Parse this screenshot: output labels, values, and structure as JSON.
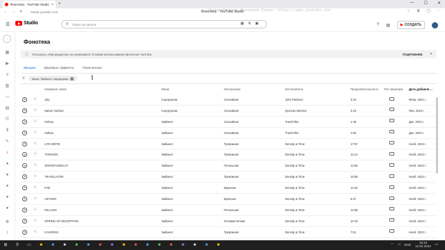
{
  "browser": {
    "tab_title": "Фонотека - YouTube Studio",
    "tab_close": "×",
    "new_tab": "+",
    "page_title": "Фонотека - YouTube Studio",
    "url": "studio.youtube.com",
    "overlay_text": "Уроки Кешина. Клоновый Канал: https://www.youtube.com",
    "win_min": "—",
    "win_max": "☐",
    "win_close": "✕"
  },
  "header": {
    "logo_text": "Studio",
    "search_placeholder": "Поиск на канале",
    "create_label": "СОЗДАТЬ"
  },
  "page": {
    "title": "Фонотека",
    "notice_text": "Пользуясь этим разделом, вы принимаете Условия использования фонотеки YouTube.",
    "notice_more": "ПОДРОБНЕЕ",
    "tabs": [
      {
        "label": "Музыка",
        "active": true
      },
      {
        "label": "Звуковые эффекты",
        "active": false
      },
      {
        "label": "Помеченные",
        "active": false
      }
    ],
    "filter_chip": "Жанр: Эмбиент, Саундтреки"
  },
  "table": {
    "headers": {
      "track": "Название трека",
      "genre": "Жанр",
      "mood": "Настроение",
      "artist": "Исполнитель",
      "duration": "Продолжительность",
      "license": "Тип лицензии",
      "added": "Дата добавле... ↓"
    },
    "rows": [
      {
        "track": "July",
        "genre": "Саундтреки",
        "mood": "Спокойная",
        "artist": "John Patitucci",
        "duration": "3:44",
        "added": "Февр. 2024 г."
      },
      {
        "track": "Nature Nurture",
        "genre": "Саундтреки",
        "mood": "Спокойная",
        "artist": "Quincas Moreira",
        "duration": "3:43",
        "added": "Янв. 2024 г."
      },
      {
        "track": "Oxbow",
        "genre": "Эмбиент",
        "mood": "Спокойная",
        "artist": "TrackTribe",
        "duration": "1:49",
        "added": "Дек. 2023 г."
      },
      {
        "track": "Holbox",
        "genre": "Эмбиент",
        "mood": "Спокойная",
        "artist": "TrackTribe",
        "duration": "1:55",
        "added": "Дек. 2023 г."
      },
      {
        "track": "LITE BRITE",
        "genre": "Эмбиент",
        "mood": "Тревожная",
        "artist": "Density & Time",
        "duration": "17:57",
        "added": "Нояб. 2023 г."
      },
      {
        "track": "TORSION",
        "genre": "Эмбиент",
        "mood": "Тревожная",
        "artist": "Density & Time",
        "duration": "11:14",
        "added": "Нояб. 2023 г."
      },
      {
        "track": "GROWTH/DECAY",
        "genre": "Эмбиент",
        "mood": "Печальная",
        "artist": "Density & Time",
        "duration": "12:50",
        "added": "Нояб. 2023 г."
      },
      {
        "track": "TRAVELATOR",
        "genre": "Эмбиент",
        "mood": "Тревожная",
        "artist": "Density & Time",
        "duration": "15:59",
        "added": "Нояб. 2023 г."
      },
      {
        "track": "FAB",
        "genre": "Эмбиент",
        "mood": "Мрачная",
        "artist": "Density & Time",
        "duration": "14:40",
        "added": "Нояб. 2023 г."
      },
      {
        "track": "AETHER",
        "genre": "Эмбиент",
        "mood": "Мрачная",
        "artist": "Density & Time",
        "duration": "8:47",
        "added": "Нояб. 2023 г."
      },
      {
        "track": "PELAGIC",
        "genre": "Эмбиент",
        "mood": "Печальная",
        "artist": "Density & Time",
        "duration": "12:58",
        "added": "Нояб. 2023 г."
      },
      {
        "track": "SPRING OF DECEPTION",
        "genre": "Эмбиент",
        "mood": "Оптимистичная",
        "artist": "Density & Time",
        "duration": "13:15",
        "added": "Нояб. 2023 г."
      },
      {
        "track": "CAVERNS",
        "genre": "Эмбиент",
        "mood": "Тревожная",
        "artist": "Density & Time",
        "duration": "7:51",
        "added": "Нояб. 2023 г."
      }
    ]
  },
  "taskbar": {
    "lang": "ENG",
    "time": "18:19",
    "date": "12.02.2024"
  }
}
